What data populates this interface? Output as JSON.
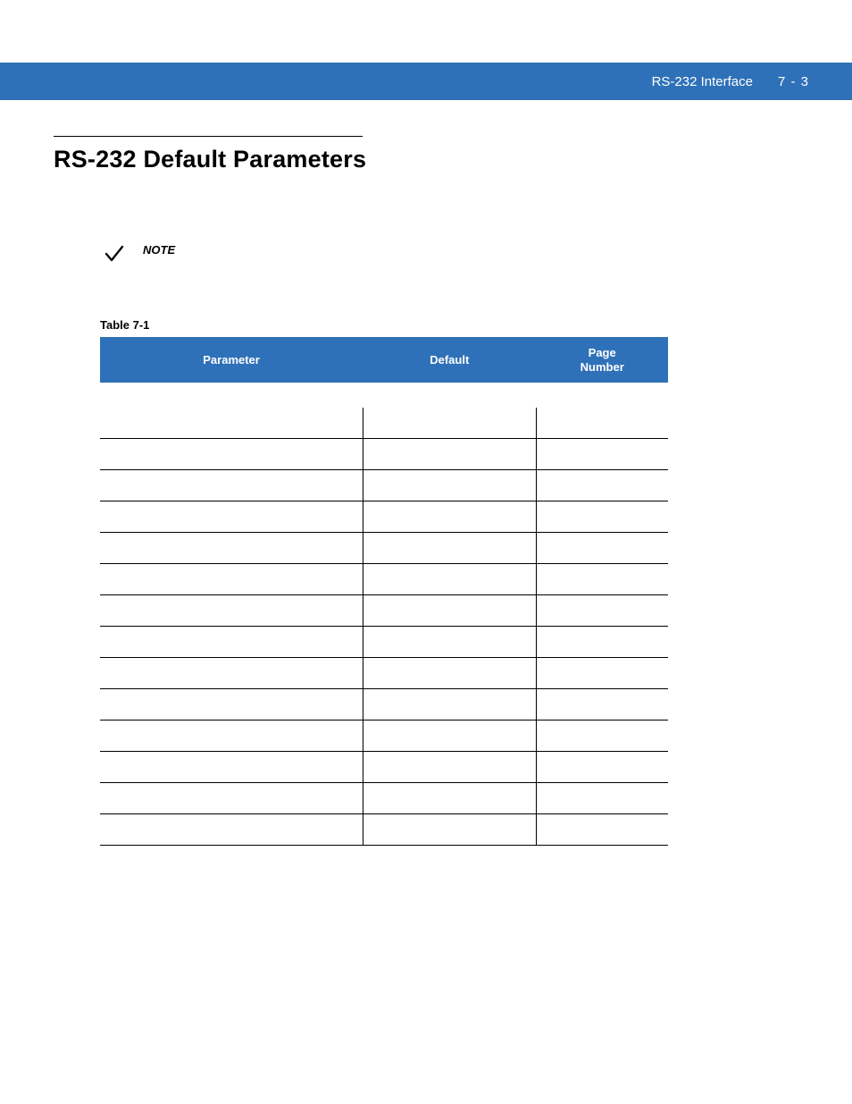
{
  "header": {
    "text": "RS-232 Interface",
    "page_label": "7 - 3"
  },
  "section": {
    "title": "RS-232 Default Parameters"
  },
  "note": {
    "label": "NOTE"
  },
  "table": {
    "caption": "Table 7-1",
    "columns": {
      "parameter": "Parameter",
      "default": "Default",
      "page": "Page\nNumber"
    },
    "section_row_label": "",
    "rows": [
      {
        "parameter": "",
        "default": "",
        "page": ""
      },
      {
        "parameter": "",
        "default": "",
        "page": ""
      },
      {
        "parameter": "",
        "default": "",
        "page": ""
      },
      {
        "parameter": "",
        "default": "",
        "page": ""
      },
      {
        "parameter": "",
        "default": "",
        "page": ""
      },
      {
        "parameter": "",
        "default": "",
        "page": ""
      },
      {
        "parameter": "",
        "default": "",
        "page": ""
      },
      {
        "parameter": "",
        "default": "",
        "page": ""
      },
      {
        "parameter": "",
        "default": "",
        "page": ""
      },
      {
        "parameter": "",
        "default": "",
        "page": ""
      },
      {
        "parameter": "",
        "default": "",
        "page": ""
      },
      {
        "parameter": "",
        "default": "",
        "page": ""
      },
      {
        "parameter": "",
        "default": "",
        "page": ""
      },
      {
        "parameter": "",
        "default": "",
        "page": ""
      }
    ]
  }
}
